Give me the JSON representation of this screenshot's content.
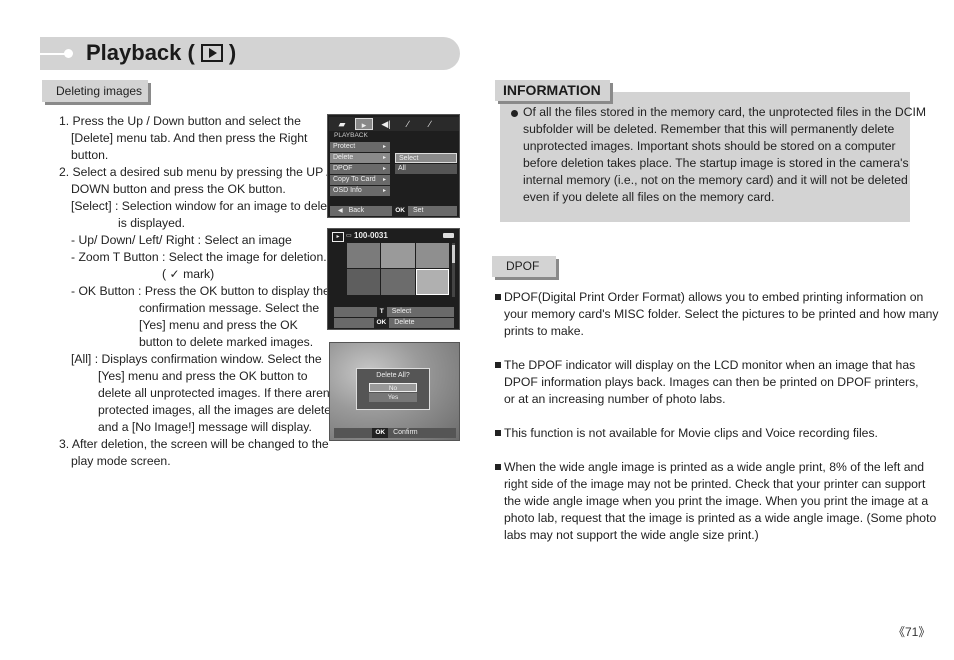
{
  "header": {
    "title_prefix": "Playback (",
    "title_suffix": ")",
    "icon": "play-mode-icon"
  },
  "section_deleting": {
    "label": "Deleting images"
  },
  "steps": [
    "1. Press the Up / Down button and select the",
    "[Delete] menu tab. And then press the Right",
    "button.",
    "2. Select a desired sub menu by pressing the UP /",
    "DOWN button and press the OK button.",
    "[Select] : Selection window for an image to delete",
    "is displayed.",
    "- Up/ Down/ Left/ Right : Select an image",
    "- Zoom T Button : Select the image for deletion.",
    "mark)",
    "- OK Button : Press the OK button to display the",
    "confirmation message. Select the",
    "[Yes] menu and press the OK",
    "button to delete marked images.",
    "[All] : Displays confirmation window. Select the",
    "[Yes] menu and press the OK button to",
    "delete all unprotected images. If there aren't",
    "protected images, all the images are deleted",
    "and a [No Image!] message will display.",
    "3. After deletion, the screen will be changed to the",
    "play mode screen."
  ],
  "screen1": {
    "menu_title": "PLAYBACK",
    "items": [
      "Protect",
      "Delete",
      "DPOF",
      "Copy To Card",
      "OSD Info"
    ],
    "selected_item": "Delete",
    "submenu": [
      "Select",
      "All"
    ],
    "selected_sub": "Select",
    "footer_back": "Back",
    "footer_ok": "OK",
    "footer_set": "Set"
  },
  "screen2": {
    "file_number": "100-0031",
    "footer": [
      {
        "key": "T",
        "label": "Select"
      },
      {
        "key": "OK",
        "label": "Delete"
      }
    ]
  },
  "screen3": {
    "dialog_title": "Delete All?",
    "options": [
      "No",
      "Yes"
    ],
    "selected_option": "No",
    "footer_ok": "OK",
    "footer_label": "Confirm"
  },
  "information": {
    "label": "INFORMATION",
    "lines": [
      "Of all the files stored in the memory card, the unprotected files in the DCIM",
      "subfolder will be deleted. Remember that this will permanently delete",
      "unprotected images. Important shots should be stored on a computer",
      "before deletion takes place. The startup image is stored in the camera's",
      "internal memory (i.e., not on the memory card) and it will not be deleted",
      "even if you delete all files on the memory card."
    ]
  },
  "section_dpof": {
    "label": "DPOF"
  },
  "dpof_paragraphs": [
    [
      "DPOF(Digital Print Order Format) allows you to embed printing information on",
      "your memory card's MISC folder. Select the pictures to be printed and how many",
      "prints to make."
    ],
    [
      "The DPOF indicator will display on the LCD monitor when an image that has",
      "DPOF information plays back. Images can then be printed on DPOF printers,",
      "or at an increasing number of photo labs."
    ],
    [
      "This function is not available for Movie clips and Voice recording files."
    ],
    [
      "When the wide angle image is printed as a wide angle print, 8% of the left and",
      "right side of the image may not be printed. Check that your printer can support",
      "the wide angle image when you print the image. When you print the image at a",
      "photo lab, request that the image is printed as a wide angle image. (Some photo",
      "labs may not support the wide angle size print.)"
    ]
  ],
  "page_number": "《71》"
}
